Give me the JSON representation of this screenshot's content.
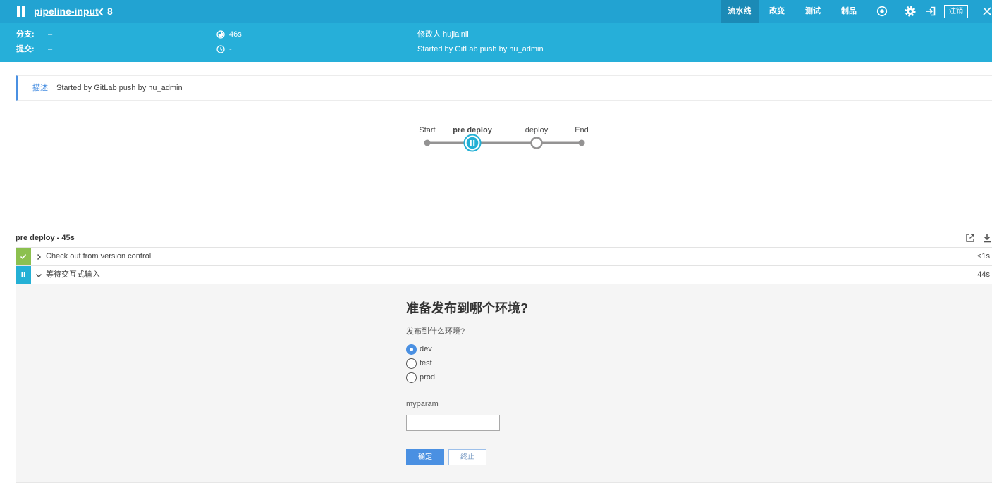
{
  "header": {
    "status_icon": "paused-icon",
    "run_name": "pipeline-input",
    "run_number": "8",
    "tabs": [
      {
        "label": "流水线",
        "active": true
      },
      {
        "label": "改变",
        "active": false
      },
      {
        "label": "测试",
        "active": false
      },
      {
        "label": "制品",
        "active": false
      }
    ],
    "logout_label": "注销"
  },
  "run_info": {
    "branch_label": "分支:",
    "branch_value": "–",
    "commit_label": "提交:",
    "commit_value": "–",
    "duration": "46s",
    "end_time": "-",
    "changes": "修改人 hujiainli",
    "cause": "Started by GitLab push by hu_admin"
  },
  "description": {
    "label": "描述",
    "text": "Started by GitLab push by hu_admin"
  },
  "graph": {
    "nodes": [
      {
        "label": "Start",
        "icon": "start-dot-icon"
      },
      {
        "label": "pre deploy",
        "icon": "paused-node-icon"
      },
      {
        "label": "deploy",
        "icon": "not-built-node-icon"
      },
      {
        "label": "End",
        "icon": "end-dot-icon"
      }
    ]
  },
  "steps": {
    "title": "pre deploy - 45s",
    "items": [
      {
        "label": "Check out from version control",
        "duration": "<1s",
        "icon": "success-check-icon",
        "expanded": false
      },
      {
        "label": "等待交互式输入",
        "duration": "44s",
        "icon": "paused-icon",
        "expanded": true
      }
    ]
  },
  "input": {
    "message": "准备发布到哪个环境?",
    "choice_label": "发布到什么环境?",
    "choices": [
      {
        "label": "dev",
        "checked": true
      },
      {
        "label": "test",
        "checked": false
      },
      {
        "label": "prod",
        "checked": false
      }
    ],
    "text_label": "myparam",
    "text_value": "",
    "ok_label": "确定",
    "abort_label": "终止"
  },
  "colors": {
    "header": "#22a3d2",
    "info": "#26afd9",
    "tab_active": "#1b8ab6",
    "success": "#8cc04f",
    "paused": "#24b0d5",
    "primary": "#4a90e2",
    "muted": "#949393"
  }
}
